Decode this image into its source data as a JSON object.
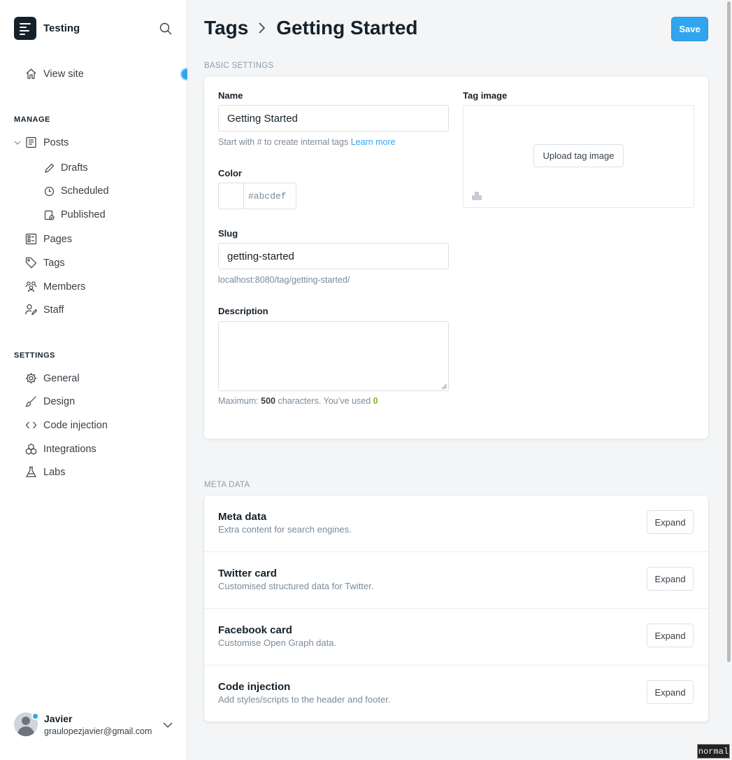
{
  "sidebar": {
    "site_title": "Testing",
    "view_site": "View site",
    "manage_label": "MANAGE",
    "manage_items": {
      "posts": "Posts",
      "drafts": "Drafts",
      "scheduled": "Scheduled",
      "published": "Published",
      "pages": "Pages",
      "tags": "Tags",
      "members": "Members",
      "staff": "Staff"
    },
    "settings_label": "SETTINGS",
    "settings_items": {
      "general": "General",
      "design": "Design",
      "code_injection": "Code injection",
      "integrations": "Integrations",
      "labs": "Labs"
    },
    "user": {
      "name": "Javier",
      "email": "graulopezjavier@gmail.com"
    }
  },
  "header": {
    "crumb_parent": "Tags",
    "crumb_current": "Getting Started",
    "save_label": "Save"
  },
  "basic_settings": {
    "group_label": "BASIC SETTINGS",
    "name_label": "Name",
    "name_value": "Getting Started",
    "name_hint": "Start with # to create internal tags",
    "learn_more": "Learn more",
    "color_label": "Color",
    "color_placeholder": "#abcdef",
    "slug_label": "Slug",
    "slug_value": "getting-started",
    "slug_url": "localhost:8080/tag/getting-started/",
    "description_label": "Description",
    "desc_hint_prefix": "Maximum: ",
    "desc_max": "500",
    "desc_hint_middle": " characters. You’ve used ",
    "desc_used": "0",
    "tag_image_label": "Tag image",
    "upload_label": "Upload tag image"
  },
  "meta_data": {
    "group_label": "META DATA",
    "rows": [
      {
        "title": "Meta data",
        "desc": "Extra content for search engines.",
        "button": "Expand"
      },
      {
        "title": "Twitter card",
        "desc": "Customised structured data for Twitter.",
        "button": "Expand"
      },
      {
        "title": "Facebook card",
        "desc": "Customise Open Graph data.",
        "button": "Expand"
      },
      {
        "title": "Code injection",
        "desc": "Add styles/scripts to the header and footer.",
        "button": "Expand"
      }
    ]
  },
  "mode_badge": "normal",
  "colors": {
    "accent": "#30a5ee",
    "used_count": "#7fb42f",
    "text": "#15212a",
    "muted": "#7c8b9a"
  }
}
